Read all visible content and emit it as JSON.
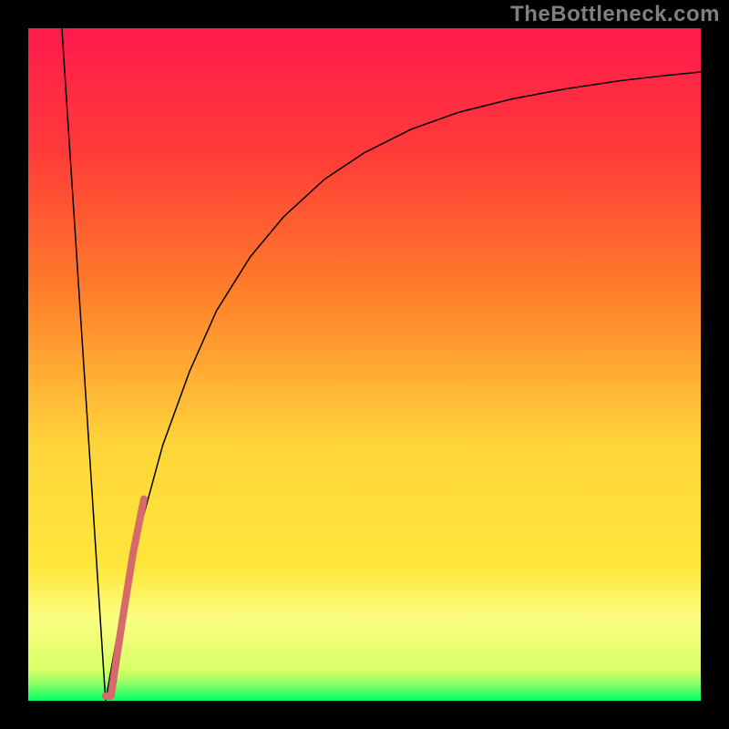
{
  "watermark": "TheBottleneck.com",
  "chart_data": {
    "type": "line",
    "title": "",
    "xlabel": "",
    "ylabel": "",
    "xlim": [
      0,
      100
    ],
    "ylim": [
      0,
      100
    ],
    "grid": false,
    "legend": false,
    "background_gradient": {
      "top_color": "#ff1a4d",
      "upper_mid_color": "#ff7a2a",
      "mid_color": "#ffe63b",
      "lower_band": "#fbff82",
      "bottom_color": "#00ff66"
    },
    "series": [
      {
        "name": "left-line",
        "type": "line",
        "color": "#000000",
        "width": 1.5,
        "x": [
          5.0,
          11.5
        ],
        "y": [
          100.0,
          0.0
        ]
      },
      {
        "name": "right-curve",
        "type": "line",
        "color": "#000000",
        "width": 1.5,
        "x": [
          11.5,
          14,
          17,
          20,
          24,
          28,
          33,
          38,
          44,
          50,
          57,
          64,
          72,
          80,
          88,
          95,
          100
        ],
        "y": [
          0.0,
          14,
          27,
          38,
          49,
          58,
          66,
          72,
          77.5,
          81.5,
          85,
          87.5,
          89.5,
          91,
          92.2,
          93,
          93.5
        ]
      },
      {
        "name": "highlight-segment",
        "type": "line",
        "color": "#d66a6a",
        "width": 8,
        "x": [
          11.5,
          12.3,
          14.0,
          15.6,
          17.2
        ],
        "y": [
          0.7,
          0.7,
          12.0,
          22.0,
          30.0
        ]
      }
    ]
  }
}
